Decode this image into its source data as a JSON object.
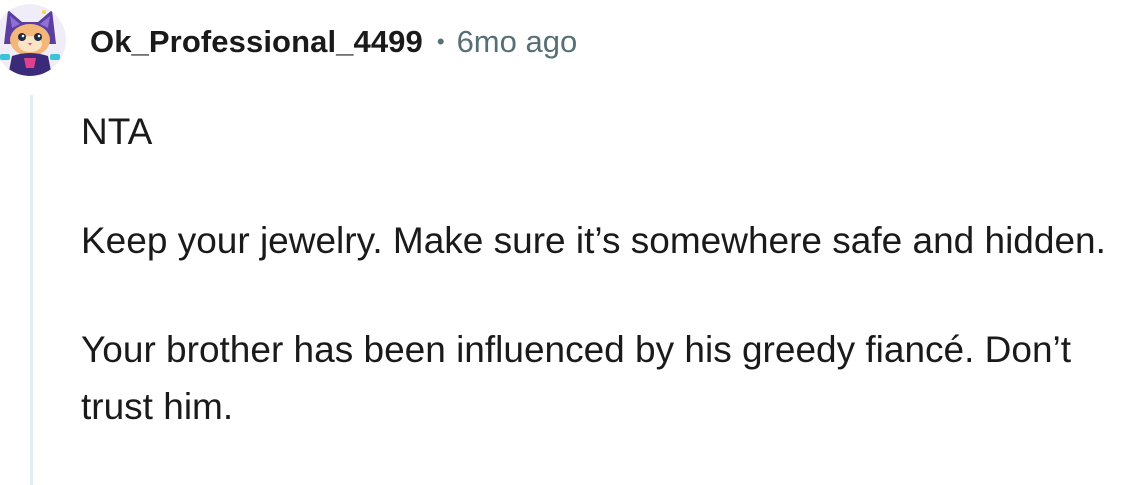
{
  "comment": {
    "author": "Ok_Professional_4499",
    "separator": "•",
    "timestamp": "6mo ago",
    "avatar_icon": "cat-snoo-avatar-icon",
    "paragraphs": [
      "NTA",
      "Keep your jewelry. Make sure it’s somewhere safe and hidden.",
      "Your brother has been influenced by his greedy fiancé. Don’t trust him."
    ]
  },
  "colors": {
    "text": "#1a1a1b",
    "meta": "#576f76",
    "thread_line": "#e5ebee",
    "avatar_purple": "#5b3fa0",
    "avatar_cyan": "#39c4d8"
  }
}
